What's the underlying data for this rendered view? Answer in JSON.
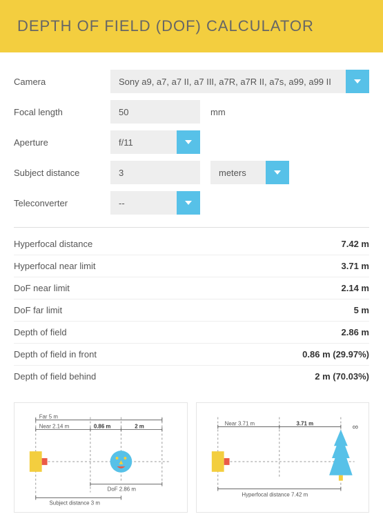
{
  "header": {
    "title": "DEPTH OF FIELD (DOF) CALCULATOR"
  },
  "form": {
    "camera": {
      "label": "Camera",
      "value": "Sony a9, a7, a7 II, a7 III, a7R, a7R II, a7s, a99, a99 II"
    },
    "focal_length": {
      "label": "Focal length",
      "value": "50",
      "unit": "mm"
    },
    "aperture": {
      "label": "Aperture",
      "value": "f/11"
    },
    "subject_distance": {
      "label": "Subject distance",
      "value": "3",
      "unit": "meters"
    },
    "teleconverter": {
      "label": "Teleconverter",
      "value": "--"
    }
  },
  "results": [
    {
      "label": "Hyperfocal distance",
      "value": "7.42 m"
    },
    {
      "label": "Hyperfocal near limit",
      "value": "3.71 m"
    },
    {
      "label": "DoF near limit",
      "value": "2.14 m"
    },
    {
      "label": "DoF far limit",
      "value": "5 m"
    },
    {
      "label": "Depth of field",
      "value": "2.86 m"
    },
    {
      "label": "Depth of field in front",
      "value": "0.86 m (29.97%)"
    },
    {
      "label": "Depth of field behind",
      "value": "2 m (70.03%)"
    }
  ],
  "diagram_dof": {
    "far_label": "Far",
    "far_value": "5 m",
    "near_label": "Near",
    "near_value": "2.14 m",
    "front_value": "0.86 m",
    "behind_value": "2 m",
    "dof_label": "DoF",
    "dof_value": "2.86 m",
    "subject_label": "Subject distance",
    "subject_value": "3 m"
  },
  "diagram_hf": {
    "near_label": "Near",
    "near_value": "3.71 m",
    "half_value": "3.71 m",
    "infinity": "∞",
    "hf_label": "Hyperfocal distance",
    "hf_value": "7.42 m"
  }
}
